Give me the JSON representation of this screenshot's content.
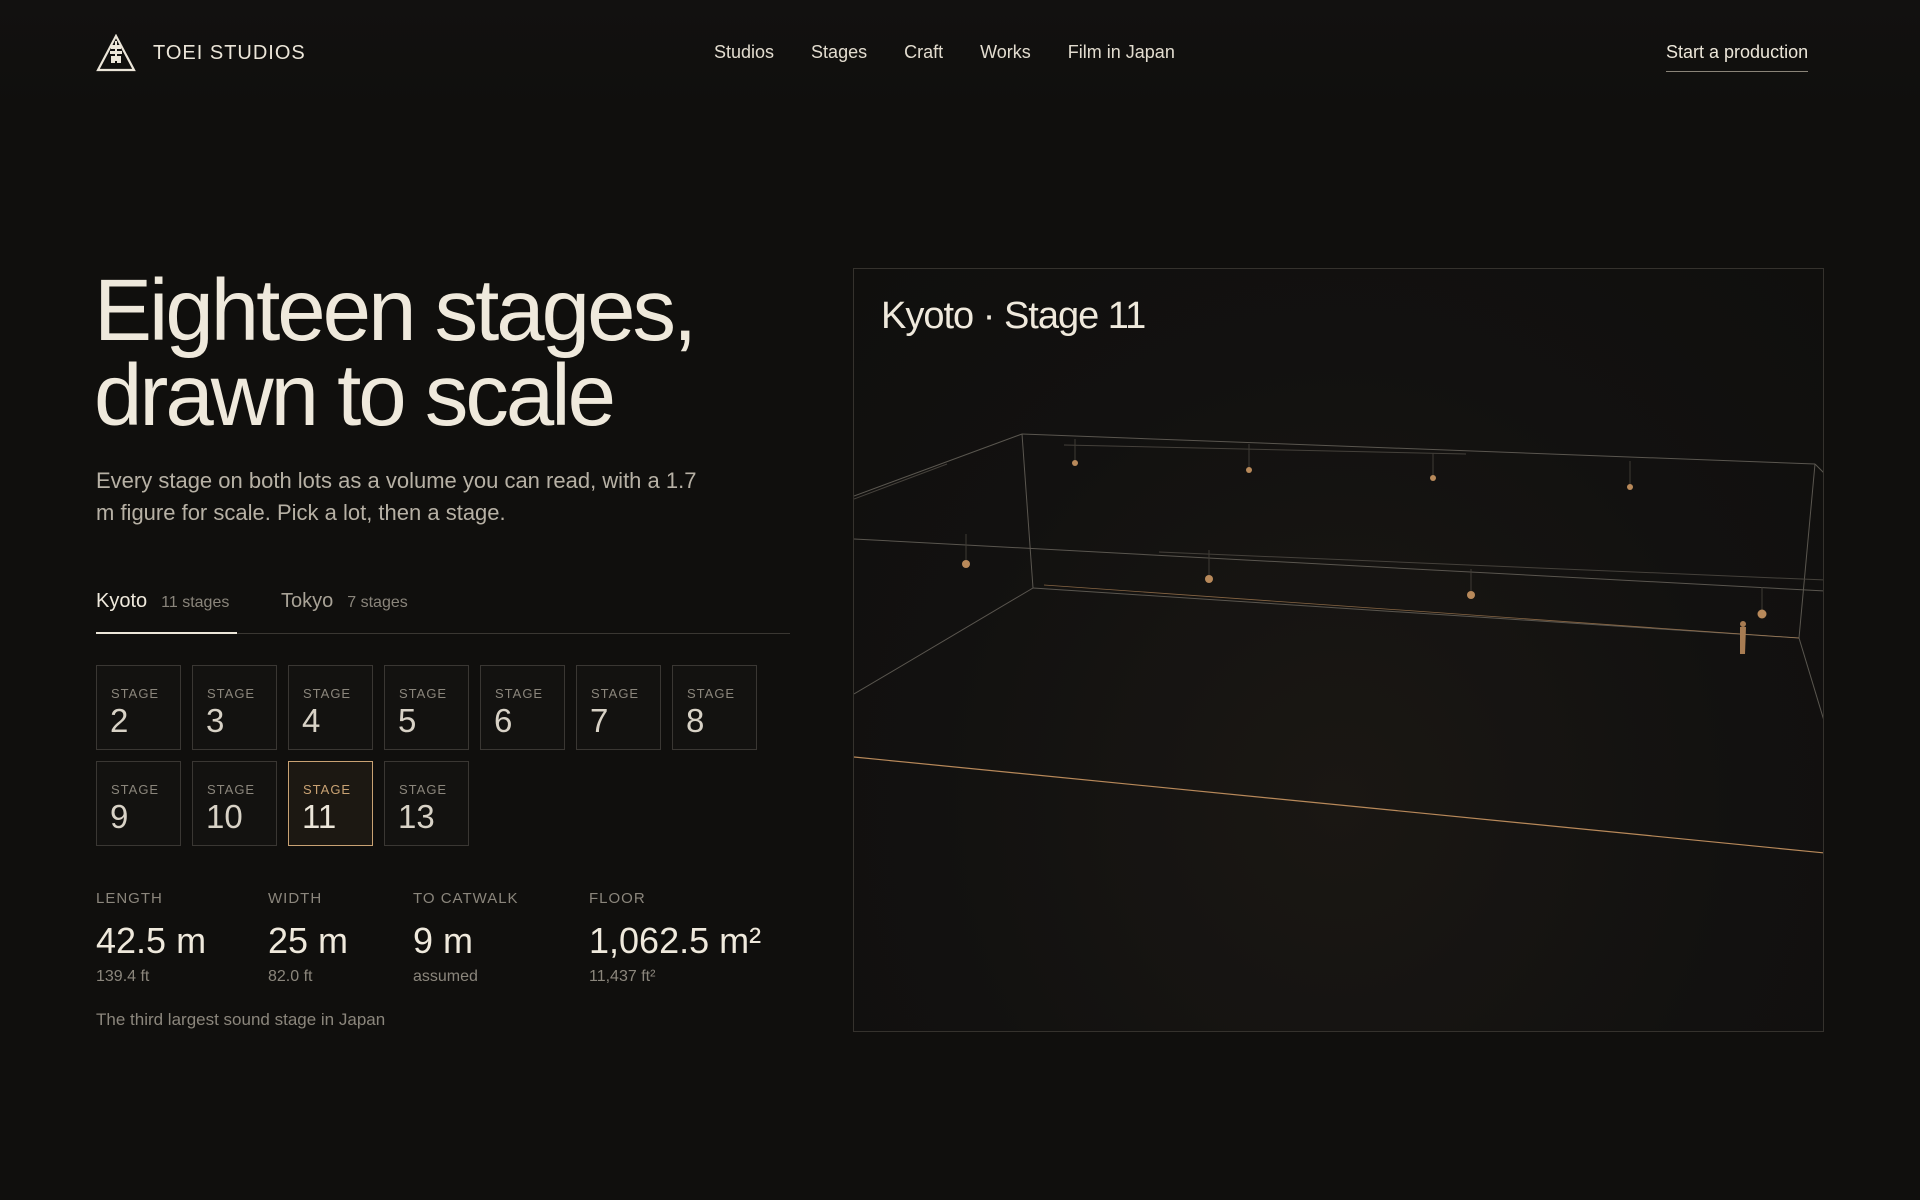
{
  "header": {
    "logo_icon": "toei-triangle-logo-icon",
    "brand_name": "TOEI STUDIOS",
    "nav": [
      {
        "label": "Studios"
      },
      {
        "label": "Stages"
      },
      {
        "label": "Craft"
      },
      {
        "label": "Works"
      },
      {
        "label": "Film in Japan"
      }
    ],
    "cta_label": "Start a production"
  },
  "hero": {
    "title_line1": "Eighteen stages,",
    "title_line2": "drawn to scale",
    "subtitle": "Every stage on both lots as a volume you can read, with a 1.7 m figure for scale. Pick a lot, then a stage."
  },
  "lots": [
    {
      "name": "Kyoto",
      "count": "11 stages",
      "active": true
    },
    {
      "name": "Tokyo",
      "count": "7 stages",
      "active": false
    }
  ],
  "stages": [
    {
      "label": "STAGE",
      "number": "2"
    },
    {
      "label": "STAGE",
      "number": "3"
    },
    {
      "label": "STAGE",
      "number": "4"
    },
    {
      "label": "STAGE",
      "number": "5"
    },
    {
      "label": "STAGE",
      "number": "6"
    },
    {
      "label": "STAGE",
      "number": "7"
    },
    {
      "label": "STAGE",
      "number": "8"
    },
    {
      "label": "STAGE",
      "number": "9"
    },
    {
      "label": "STAGE",
      "number": "10"
    },
    {
      "label": "STAGE",
      "number": "11",
      "selected": true
    },
    {
      "label": "STAGE",
      "number": "13"
    }
  ],
  "stats": [
    {
      "key": "LENGTH",
      "value": "42.5 m",
      "sub": "139.4 ft"
    },
    {
      "key": "WIDTH",
      "value": "25 m",
      "sub": "82.0 ft"
    },
    {
      "key": "TO CATWALK",
      "value": "9 m",
      "sub": "assumed"
    },
    {
      "key": "FLOOR",
      "value": "1,062.5 m²",
      "sub": "11,437 ft²"
    }
  ],
  "stage_note": "The third largest sound stage in Japan",
  "viewer": {
    "title": "Kyoto · Stage 11",
    "wire_color": "#5a564f",
    "accent_color": "#b8895a"
  },
  "colors": {
    "background": "#100f0d",
    "text": "#ece6d9",
    "muted": "#8b867c",
    "accent": "#c9a273"
  }
}
